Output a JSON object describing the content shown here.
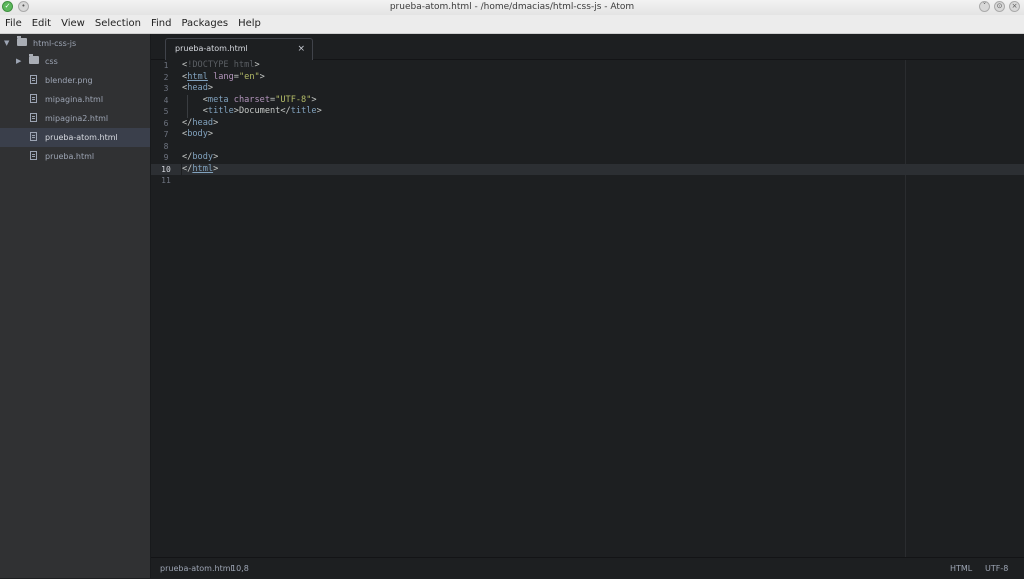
{
  "window": {
    "title": "prueba-atom.html - /home/dmacias/html-css-js - Atom"
  },
  "menu": [
    "File",
    "Edit",
    "View",
    "Selection",
    "Find",
    "Packages",
    "Help"
  ],
  "tree": {
    "root": "html-css-js",
    "items": [
      {
        "label": "css",
        "type": "folder"
      },
      {
        "label": "blender.png",
        "type": "image"
      },
      {
        "label": "mipagina.html",
        "type": "file"
      },
      {
        "label": "mipagina2.html",
        "type": "file"
      },
      {
        "label": "prueba-atom.html",
        "type": "file",
        "selected": true
      },
      {
        "label": "prueba.html",
        "type": "file"
      }
    ]
  },
  "tab": {
    "title": "prueba-atom.html",
    "close": "×"
  },
  "editor": {
    "current_line": 10,
    "line_numbers": [
      "1",
      "2",
      "3",
      "4",
      "5",
      "6",
      "7",
      "8",
      "9",
      "10",
      "11"
    ]
  },
  "status": {
    "file": "prueba-atom.html",
    "cursor": "10,8",
    "grammar": "HTML",
    "encoding": "UTF-8"
  }
}
